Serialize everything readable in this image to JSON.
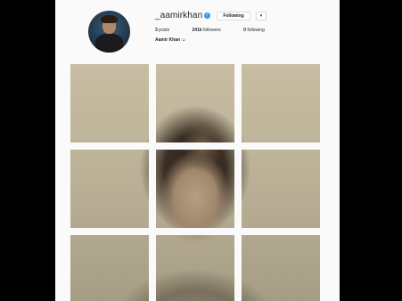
{
  "profile": {
    "username": "_aamirkhan",
    "verified_mark": "✓",
    "follow_label": "Following",
    "more_label": "▾",
    "posts_count": "3",
    "posts_label": "posts",
    "followers_count": "241k",
    "followers_label": "followers",
    "following_count": "0",
    "following_label": "following",
    "full_name": "Aamir Khan ☺"
  },
  "colors": {
    "verified_blue": "#3897f0",
    "background": "#fafafa"
  },
  "icons": {
    "verified": "verified-badge-icon",
    "more": "chevron-down-icon"
  },
  "grid": {
    "tiles": 9
  }
}
